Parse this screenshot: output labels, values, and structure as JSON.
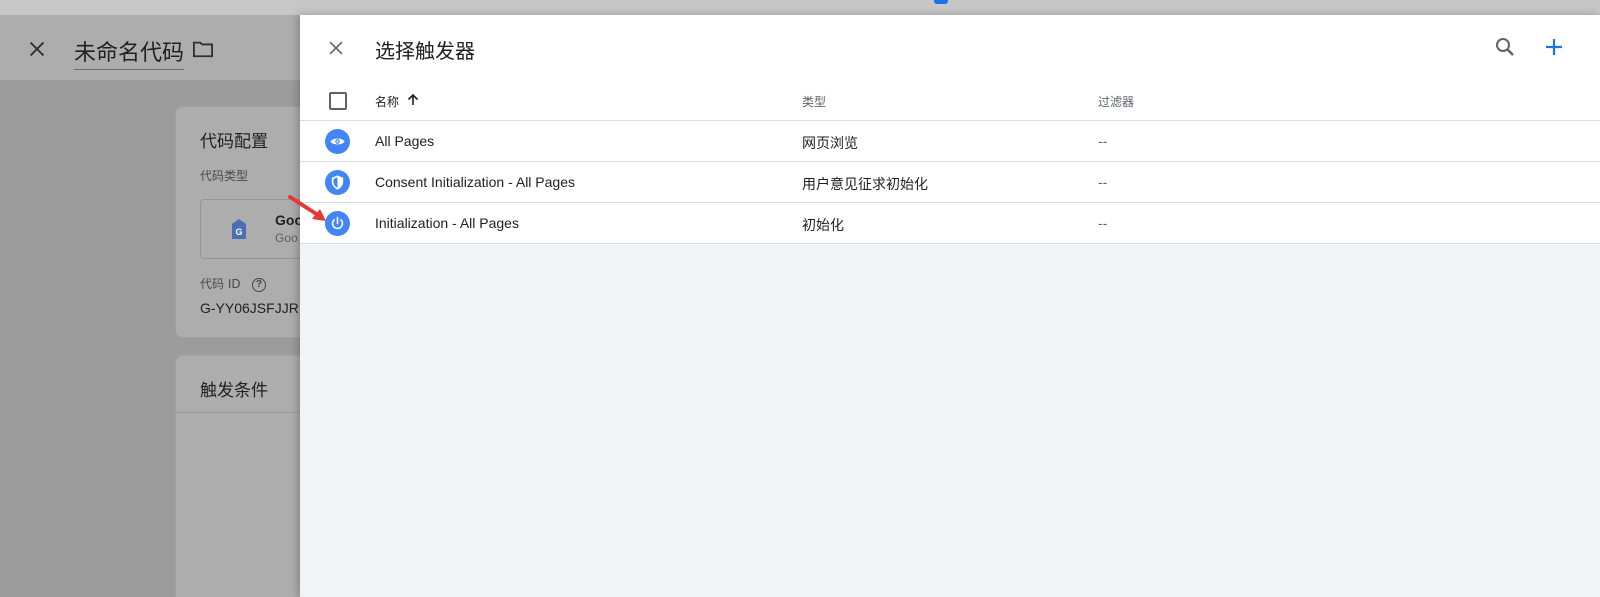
{
  "colors": {
    "accent": "#1a73e8",
    "trigger_icon": "#4285f4",
    "annotation_arrow": "#e53935"
  },
  "background": {
    "title": "未命名代码",
    "tag_config": {
      "title": "代码配置",
      "type_label": "代码类型",
      "type_name": "Goo",
      "type_sub": "Goo",
      "id_label": "代码 ID",
      "id_value": "G-YY06JSFJJR"
    },
    "trigger_card": {
      "title": "触发条件"
    }
  },
  "panel": {
    "title": "选择触发器",
    "columns": {
      "name": "名称",
      "type": "类型",
      "filter": "过滤器"
    },
    "rows": [
      {
        "icon": "eye-icon",
        "name": "All Pages",
        "type": "网页浏览",
        "filter": "--"
      },
      {
        "icon": "shield-icon",
        "name": "Consent Initialization - All Pages",
        "type": "用户意见征求初始化",
        "filter": "--"
      },
      {
        "icon": "power-icon",
        "name": "Initialization - All Pages",
        "type": "初始化",
        "filter": "--"
      }
    ]
  }
}
